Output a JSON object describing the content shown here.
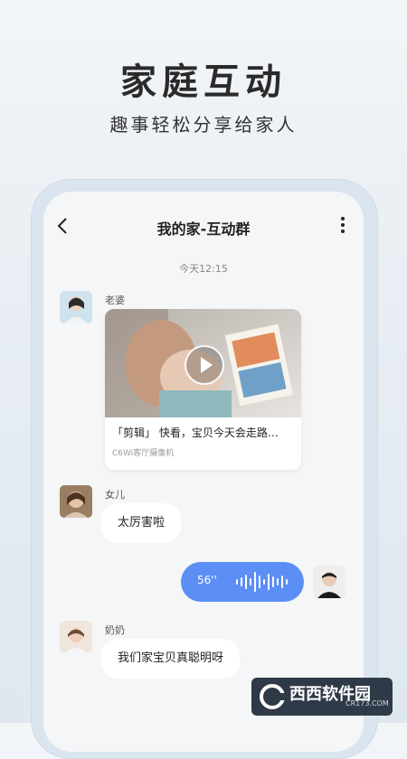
{
  "hero": {
    "title": "家庭互动",
    "subtitle": "趣事轻松分享给家人"
  },
  "chat": {
    "title": "我的家-互动群",
    "timestamp": "今天12:15",
    "messages": [
      {
        "sender": "老婆",
        "type": "video",
        "text": "「剪辑」 快看，宝贝今天会走路…",
        "source": "C6Wi客厅摄像机"
      },
      {
        "sender": "女儿",
        "type": "text",
        "text": "太厉害啦"
      },
      {
        "sender": "me",
        "type": "voice",
        "duration": "56''"
      },
      {
        "sender": "奶奶",
        "type": "text",
        "text": "我们家宝贝真聪明呀"
      }
    ]
  },
  "watermark": {
    "name": "西西软件园",
    "url": "CR173.COM"
  },
  "colors": {
    "voice_bubble": "#5b8ff5",
    "background": "#e7edf3"
  },
  "icons": [
    "back-arrow-icon",
    "more-vertical-icon",
    "play-icon",
    "voice-wave-icon"
  ]
}
